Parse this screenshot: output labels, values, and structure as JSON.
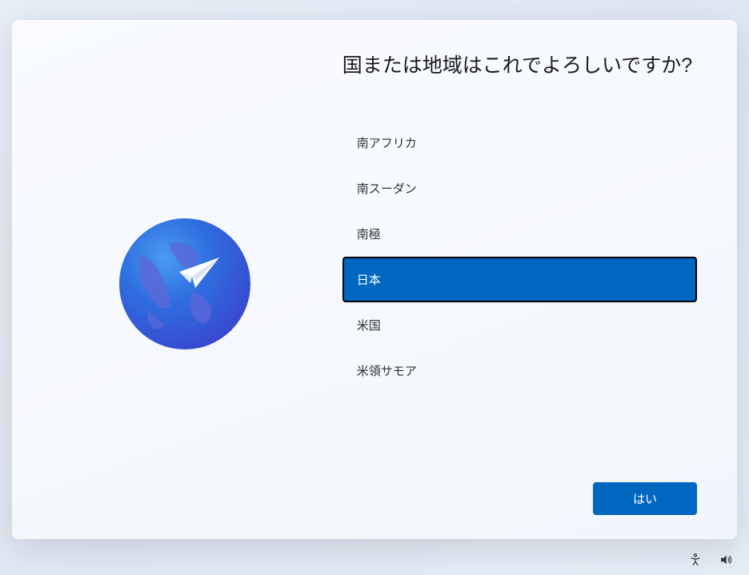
{
  "heading": "国または地域はこれでよろしいですか?",
  "regions": [
    {
      "label": "南アフリカ",
      "selected": false
    },
    {
      "label": "南スーダン",
      "selected": false
    },
    {
      "label": "南極",
      "selected": false
    },
    {
      "label": "日本",
      "selected": true
    },
    {
      "label": "米国",
      "selected": false
    },
    {
      "label": "米領サモア",
      "selected": false
    }
  ],
  "confirm_button": "はい",
  "colors": {
    "accent": "#0067c0",
    "globe_start": "#2583e8",
    "globe_end": "#3b4dd8"
  }
}
